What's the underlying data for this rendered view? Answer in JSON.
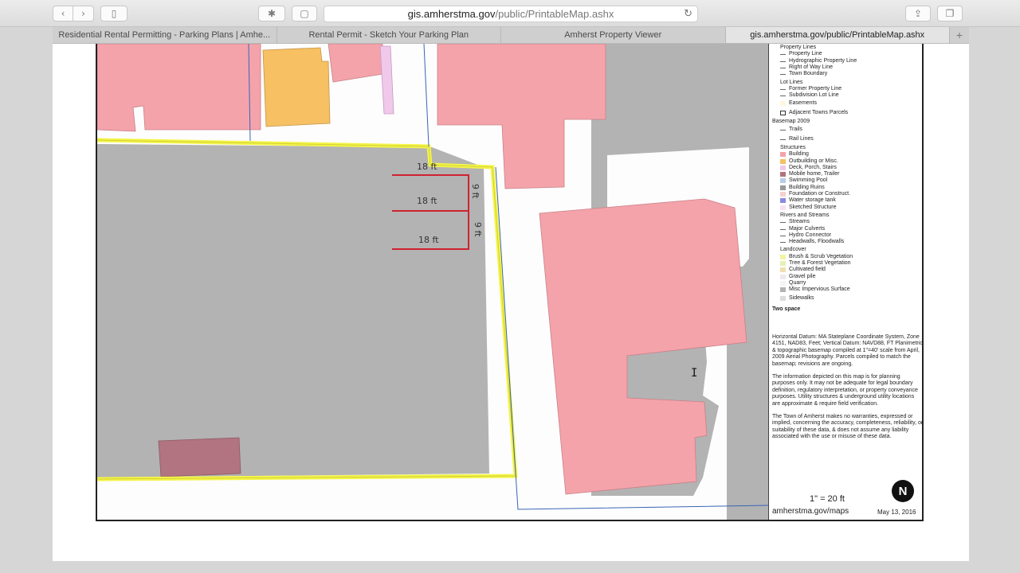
{
  "browser": {
    "url_host": "gis.amherstma.gov",
    "url_path": "/public/PrintableMap.ashx",
    "tabs": [
      {
        "label": "Residential Rental Permitting - Parking Plans | Amhe...",
        "active": false
      },
      {
        "label": "Rental Permit - Sketch Your Parking Plan",
        "active": false
      },
      {
        "label": "Amherst Property Viewer",
        "active": false
      },
      {
        "label": "gis.amherstma.gov/public/PrintableMap.ashx",
        "active": true
      }
    ],
    "new_tab": "+"
  },
  "map": {
    "labels": {
      "top_18": "18 ft",
      "mid_18": "18 ft",
      "bot_18": "18 ft",
      "nine_a": "9 ft",
      "nine_b": "9 ft"
    },
    "colors": {
      "building": "#f4a3ab",
      "building_stroke": "#c98088",
      "impervious": "#b3b3b3",
      "orange": "#f6c063",
      "lavender": "#f0c8ea",
      "mobile": "#b17480",
      "parcel_yellow": "#f4f448",
      "parking_red": "#cf2230",
      "boundary_blue": "#3b64b6"
    }
  },
  "legend": {
    "sections": [
      {
        "title": "Property Lines",
        "items": [
          "Property Line",
          "Hydrographic Property Line",
          "Right of Way Line",
          "Town Boundary"
        ]
      },
      {
        "title": "Lot Lines",
        "items": [
          "Former Property Line",
          "Subdivision Lot Line"
        ]
      },
      {
        "title": "",
        "items": [
          "Easements"
        ]
      },
      {
        "title": "",
        "items": [
          "Adjacent Towns Parcels"
        ]
      },
      {
        "title": "Basemap 2009",
        "items": []
      },
      {
        "title": "",
        "items": [
          "Trails"
        ]
      },
      {
        "title": "",
        "items": [
          "Rail Lines"
        ]
      },
      {
        "title": "Structures",
        "items": [
          "Building",
          "Outbuilding or Misc.",
          "Deck, Porch, Stairs",
          "Mobile home, Trailer",
          "Swimming Pool",
          "Building Ruins",
          "Foundation or Construct.",
          "Water storage tank",
          "Sketched Structure"
        ]
      },
      {
        "title": "Rivers and Streams",
        "items": [
          "Streams",
          "Major Culverts",
          "Hydro Connector",
          "Headwalls, Floodwalls"
        ]
      },
      {
        "title": "Landcover",
        "items": [
          "Brush & Scrub Vegetation",
          "Tree & Forest Vegetation",
          "Cultivated field",
          "Gravel pile",
          "Quarry",
          "Misc Impervious Surface"
        ]
      },
      {
        "title": "",
        "items": [
          "Sidewalks"
        ]
      }
    ],
    "two_space": "Two space",
    "datum": "Horizontal Datum: MA Stateplane Coordinate System, Zone 4151, NAD83, Feet; Vertical Datum: NAVD88, FT Planimetric & topographic basemap compiled at 1\"=40' scale from April, 2009 Aerial Photography. Parcels compiled to match the basemap; revisions are ongoing.",
    "planning": "The information depicted on this map is for planning purposes only. It may not be adequate for legal boundary definition, regulatory interpretation, or property conveyance purposes. Utility structures & underground utility locations are approximate & require field verification.",
    "warranty": "The Town of Amherst makes no warranties, expressed or implied, concerning the accuracy, completeness, reliability, or suitability of these data, & does not assume any liability associated with the use or misuse of these data.",
    "scale": "1\" = 20 ft",
    "url": "amherstma.gov/maps",
    "date": "May 13, 2016",
    "north_symbol": "N"
  }
}
